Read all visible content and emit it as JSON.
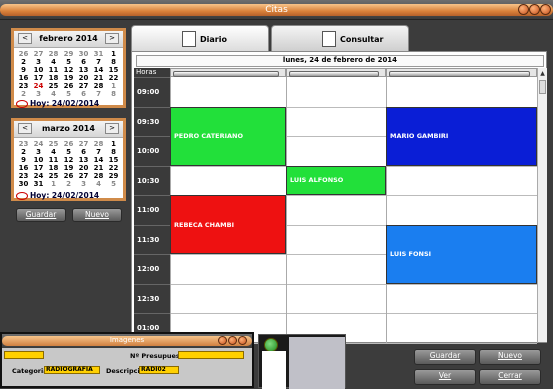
{
  "window": {
    "title": "Citas"
  },
  "calendars": [
    {
      "month": "febrero 2014",
      "prev": "<",
      "next": ">",
      "weeks": [
        [
          "26",
          "27",
          "28",
          "29",
          "30",
          "31",
          "1"
        ],
        [
          "2",
          "3",
          "4",
          "5",
          "6",
          "7",
          "8"
        ],
        [
          "9",
          "10",
          "11",
          "12",
          "13",
          "14",
          "15"
        ],
        [
          "16",
          "17",
          "18",
          "19",
          "20",
          "21",
          "22"
        ],
        [
          "23",
          "24",
          "25",
          "26",
          "27",
          "28",
          "1"
        ],
        [
          "2",
          "3",
          "4",
          "5",
          "6",
          "7",
          "8"
        ]
      ],
      "today_label": "Hoy: 24/02/2014"
    },
    {
      "month": "marzo 2014",
      "prev": "<",
      "next": ">",
      "weeks": [
        [
          "23",
          "24",
          "25",
          "26",
          "27",
          "28",
          "1"
        ],
        [
          "2",
          "3",
          "4",
          "5",
          "6",
          "7",
          "8"
        ],
        [
          "9",
          "10",
          "11",
          "12",
          "13",
          "14",
          "15"
        ],
        [
          "16",
          "17",
          "18",
          "19",
          "20",
          "21",
          "22"
        ],
        [
          "23",
          "24",
          "25",
          "26",
          "27",
          "28",
          "29"
        ],
        [
          "30",
          "31",
          "1",
          "2",
          "3",
          "4",
          "5"
        ]
      ],
      "today_label": "Hoy: 24/02/2014"
    }
  ],
  "left_buttons": {
    "save": "Guardar",
    "new": "Nuevo"
  },
  "tabs": [
    {
      "label": "Diario",
      "active": true
    },
    {
      "label": "Consultar",
      "active": false
    }
  ],
  "schedule": {
    "date_header": "lunes, 24 de febrero de 2014",
    "time_header": "Horas",
    "times": [
      "09:00 AM",
      "09:30 AM",
      "10:00 AM",
      "10:30 AM",
      "11:00 AM",
      "11:30 AM",
      "12:00 PM",
      "12:30 PM",
      "01:00 PM"
    ],
    "appointments": [
      {
        "name": "PEDRO CATERIANO",
        "column": 1,
        "start": "09:30 AM",
        "end": "10:30 AM",
        "color": "#22e03a"
      },
      {
        "name": "MARIO GAMBIRI",
        "column": 3,
        "start": "09:30 AM",
        "end": "10:30 AM",
        "color": "#0a1ed6"
      },
      {
        "name": "LUIS ALFONSO",
        "column": 2,
        "start": "10:30 AM",
        "end": "11:00 AM",
        "color": "#22e03a"
      },
      {
        "name": "REBECA CHAMBI",
        "column": 1,
        "start": "11:00 AM",
        "end": "12:00 PM",
        "color": "#ee1111"
      },
      {
        "name": "LUIS FONSI",
        "column": 3,
        "start": "11:30 AM",
        "end": "12:30 PM",
        "color": "#1a7ef0"
      }
    ]
  },
  "right_buttons": {
    "save": "Guardar",
    "new": "Nuevo",
    "view": "Ver",
    "close": "Cerrar"
  },
  "popup": {
    "title": "Imagenes",
    "budget_label": "Nº Presupuesto",
    "category_label": "Categoria",
    "category_value": "RADIOGRAFIA",
    "description_label": "Descripción",
    "description_value": "RADI02"
  },
  "colors": {
    "accent": "#d9813a",
    "green": "#22e03a",
    "red": "#ee1111",
    "blue": "#0a1ed6",
    "light_blue": "#1a7ef0"
  }
}
